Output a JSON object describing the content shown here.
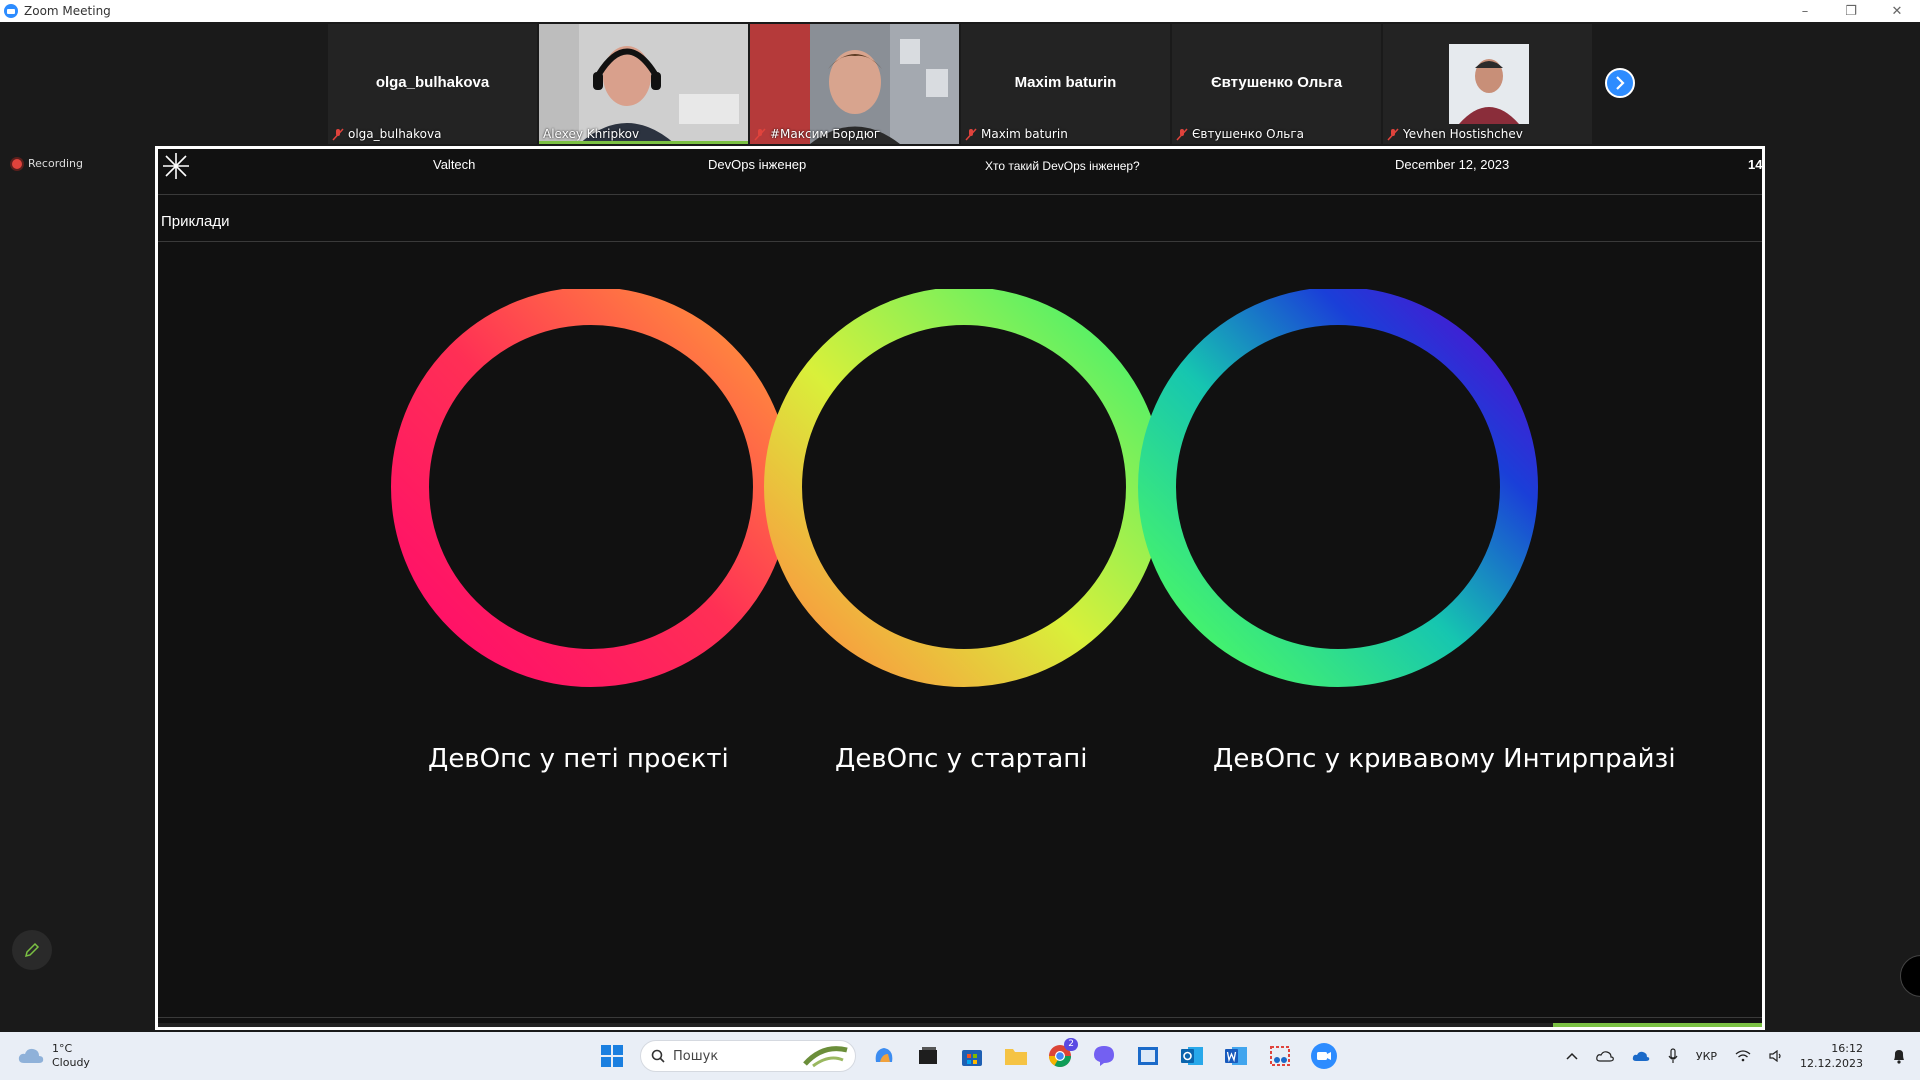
{
  "window": {
    "title": "Zoom Meeting",
    "controls": [
      "–",
      "❐",
      "✕"
    ]
  },
  "recording": {
    "label": "Recording"
  },
  "participants": [
    {
      "center_name": "olga_bulhakova",
      "tag": "olga_bulhakova",
      "video": false,
      "active": false
    },
    {
      "center_name": "",
      "tag": "Alexey Khripkov",
      "video": true,
      "active": true
    },
    {
      "center_name": "",
      "tag": "#Максим Бордюг",
      "video": true,
      "active": false
    },
    {
      "center_name": "Maxim baturin",
      "tag": "Maxim baturin",
      "video": false,
      "active": false
    },
    {
      "center_name": "Євтушенко Ольга",
      "tag": "Євтушенко Ольга",
      "video": false,
      "active": false
    },
    {
      "center_name": "",
      "tag": "Yevhen Hostishchev",
      "video": true,
      "active": false
    }
  ],
  "slide": {
    "header": {
      "company": "Valtech",
      "course": "DevOps інженер",
      "topic": "Хто такий DevOps інженер?",
      "date": "December 12, 2023",
      "page": "14"
    },
    "section_title": "Приклади",
    "rings": [
      {
        "label": "ДевОпс у петі проєкті"
      },
      {
        "label": "ДевОпс у стартапі"
      },
      {
        "label": "ДевОпс у кривавому Интирпрайзі"
      }
    ]
  },
  "taskbar": {
    "weather": {
      "temp": "1°C",
      "condition": "Cloudy"
    },
    "search_placeholder": "Пошук",
    "language": "УКР",
    "time": "16:12",
    "date": "12.12.2023",
    "chrome_badge": "2"
  },
  "colors": {
    "accent": "#2d8cff",
    "active_speaker": "#7bc143",
    "recording": "#e0433c"
  }
}
